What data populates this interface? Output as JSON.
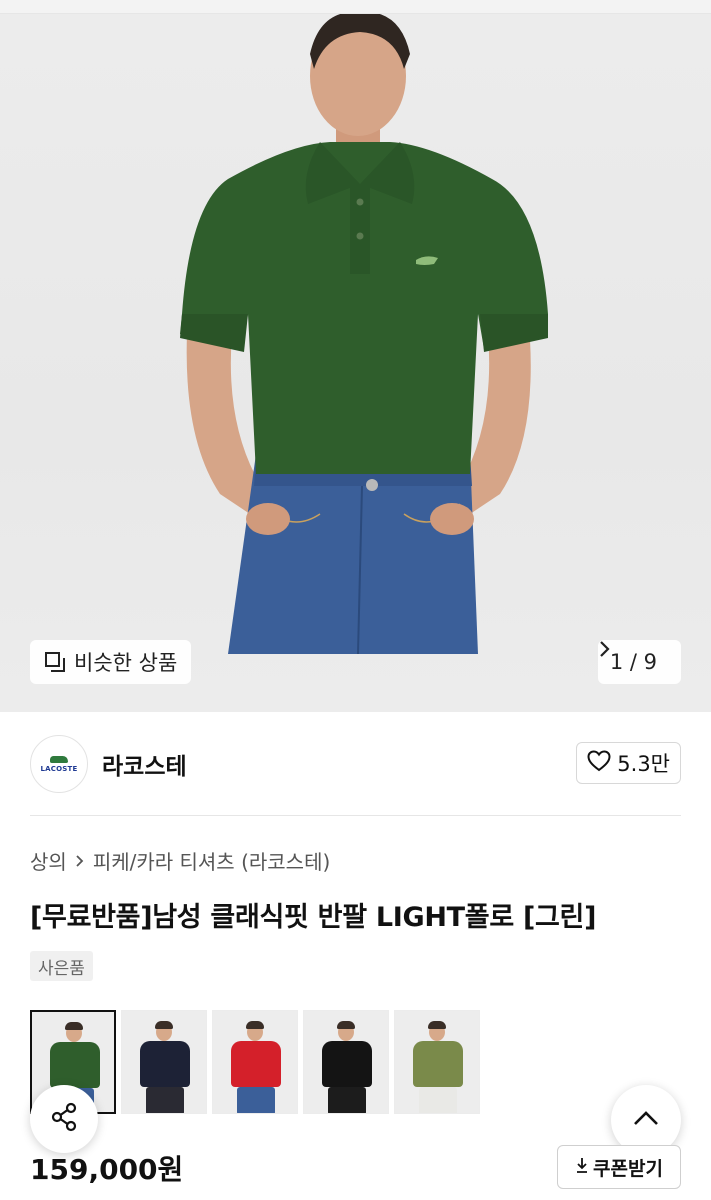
{
  "gallery": {
    "similar_label": "비슷한 상품",
    "counter": "1 / 9"
  },
  "brand": {
    "logo_text": "LACOSTE",
    "name": "라코스테",
    "likes": "5.3만"
  },
  "breadcrumb": [
    "상의",
    "피케/카라 티셔츠 (라코스테)"
  ],
  "product": {
    "title": "[무료반품]남성 클래식핏 반팔 LIGHT폴로 [그린]",
    "badge": "사은품",
    "price": "159,000원"
  },
  "color_options": [
    {
      "shirt": "#2f5e2c",
      "pants": "#3b5f99"
    },
    {
      "shirt": "#1d2236",
      "pants": "#2a2a33"
    },
    {
      "shirt": "#d4202a",
      "pants": "#3b5f99"
    },
    {
      "shirt": "#141414",
      "pants": "#1c1c1c"
    },
    {
      "shirt": "#7a8a4a",
      "pants": "#e9e9e6"
    }
  ],
  "actions": {
    "coupon_label": "쿠폰받기"
  },
  "colors": {
    "accent_green": "#2f5e2c",
    "denim": "#3b5f99"
  }
}
